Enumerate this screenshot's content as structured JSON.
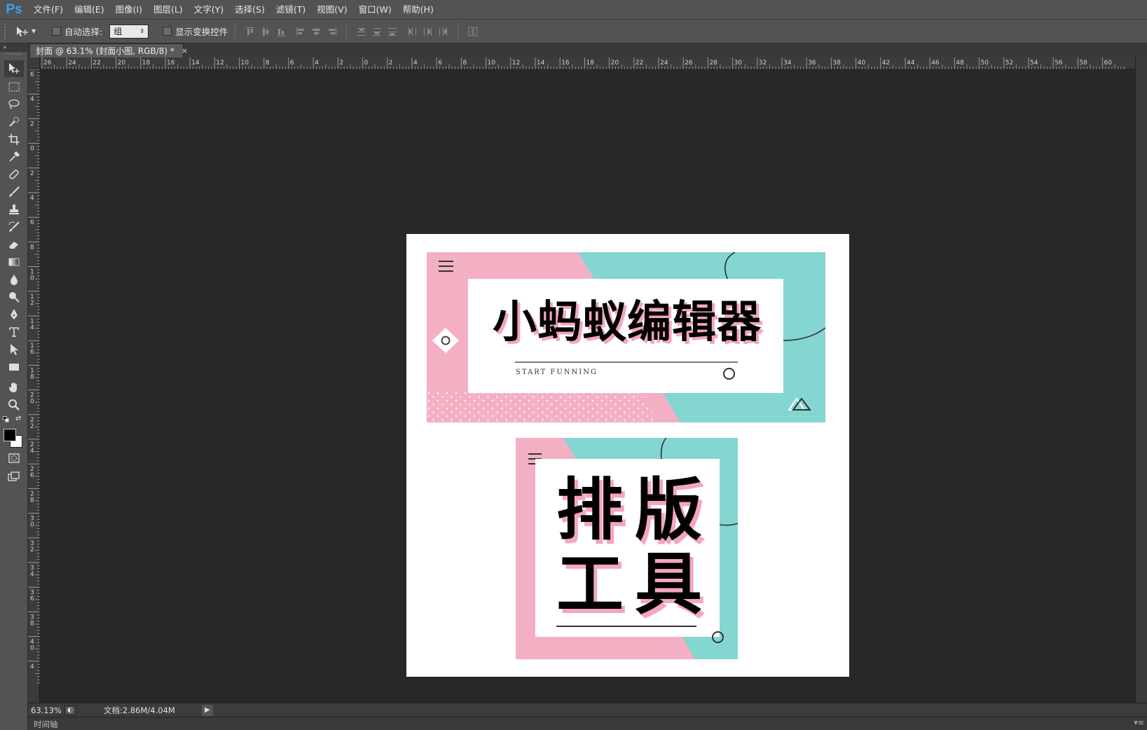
{
  "app": {
    "logo": "Ps",
    "menu": [
      "文件(F)",
      "编辑(E)",
      "图像(I)",
      "图层(L)",
      "文字(Y)",
      "选择(S)",
      "滤镜(T)",
      "视图(V)",
      "窗口(W)",
      "帮助(H)"
    ]
  },
  "options": {
    "auto_select_label": "自动选择:",
    "auto_select_value": "组",
    "show_transform_label": "显示变换控件"
  },
  "tab": {
    "title": "封面 @ 63.1% (封面小图, RGB/8) *",
    "close": "×"
  },
  "rulers": {
    "h_labels": [
      "26",
      "24",
      "22",
      "20",
      "18",
      "16",
      "14",
      "12",
      "10",
      "8",
      "6",
      "4",
      "2",
      "0",
      "2",
      "4",
      "6",
      "8",
      "10",
      "12",
      "14",
      "16",
      "18",
      "20",
      "22",
      "24",
      "26",
      "28",
      "30",
      "32",
      "34",
      "36",
      "38",
      "40",
      "42",
      "44",
      "46",
      "48",
      "50",
      "52",
      "54",
      "56",
      "58",
      "60"
    ],
    "v_labels": [
      "6",
      "4",
      "2",
      "0",
      "2",
      "4",
      "6",
      "8",
      "10",
      "12",
      "14",
      "16",
      "18",
      "20",
      "22",
      "24",
      "26",
      "28",
      "30",
      "32",
      "34",
      "36",
      "38",
      "40",
      "4"
    ]
  },
  "document": {
    "banner": {
      "title": "小蚂蚁编辑器",
      "subtitle": "START FUNNING"
    },
    "square": {
      "line1": "排版",
      "line2": "工具"
    },
    "colors": {
      "pink": "#f4b0c3",
      "teal": "#84d6d0",
      "text_shadow": "#f4a6bf"
    }
  },
  "status": {
    "zoom": "63.13%",
    "doc_size": "文档:2.86M/4.04M",
    "timeline": "时间轴"
  }
}
